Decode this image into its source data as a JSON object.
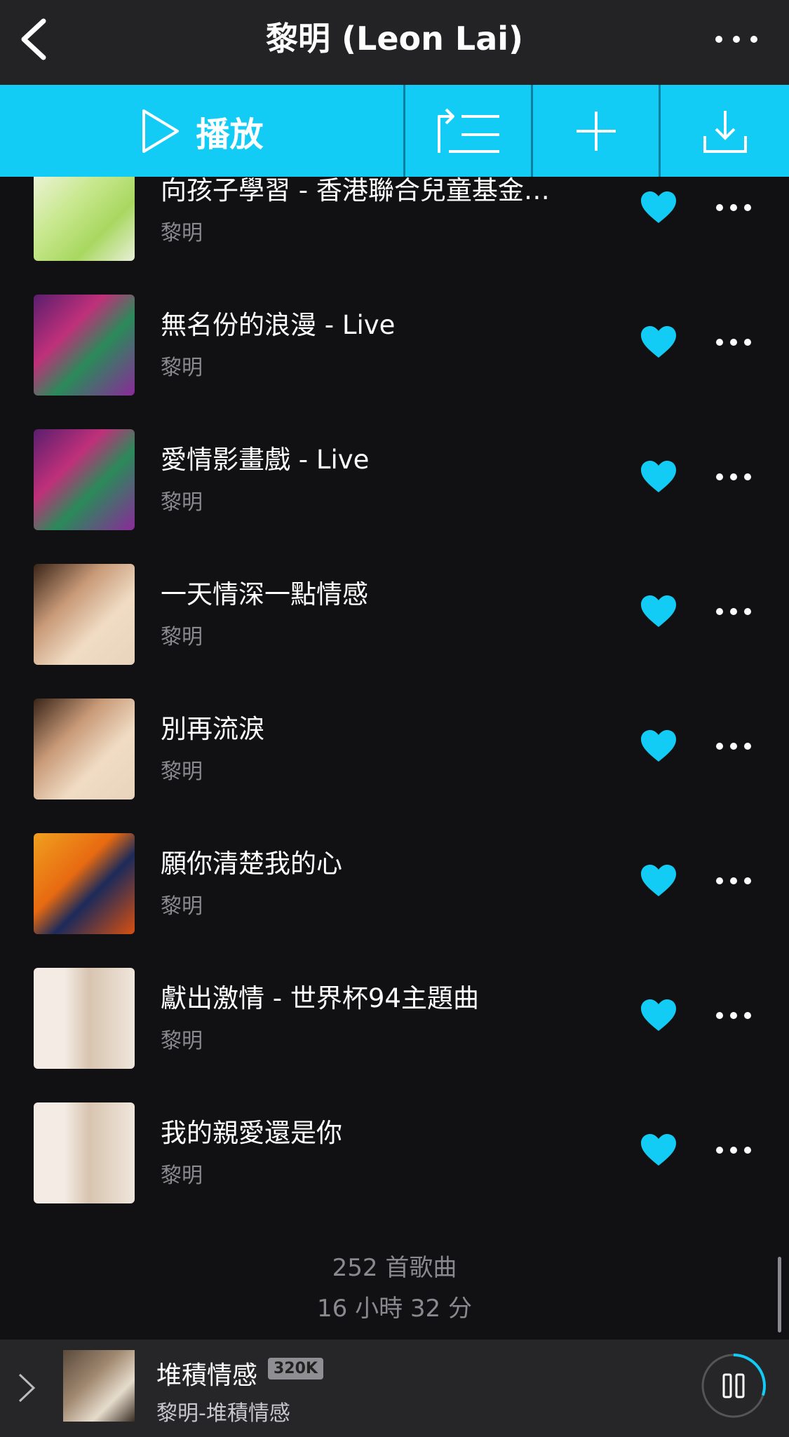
{
  "header": {
    "title": "黎明 (Leon Lai)"
  },
  "actions": {
    "play_label": "播放"
  },
  "colors": {
    "accent": "#12ccf5",
    "background": "#111113",
    "muted": "#8a8a8e"
  },
  "songs": [
    {
      "title": "向孩子學習 - 香港聯合兒童基金…",
      "artist": "黎明",
      "liked": true
    },
    {
      "title": "無名份的浪漫 - Live",
      "artist": "黎明",
      "liked": true
    },
    {
      "title": "愛情影畫戲 - Live",
      "artist": "黎明",
      "liked": true
    },
    {
      "title": "一天情深一點情感",
      "artist": "黎明",
      "liked": true
    },
    {
      "title": "別再流淚",
      "artist": "黎明",
      "liked": true
    },
    {
      "title": "願你清楚我的心",
      "artist": "黎明",
      "liked": true
    },
    {
      "title": "獻出激情 - 世界杯94主題曲",
      "artist": "黎明",
      "liked": true
    },
    {
      "title": "我的親愛還是你",
      "artist": "黎明",
      "liked": true
    }
  ],
  "footer": {
    "song_count": "252 首歌曲",
    "total_duration": "16 小時 32 分"
  },
  "now_playing": {
    "title": "堆積情感",
    "quality": "320K",
    "subtitle": "黎明-堆積情感",
    "progress": 0.3
  }
}
